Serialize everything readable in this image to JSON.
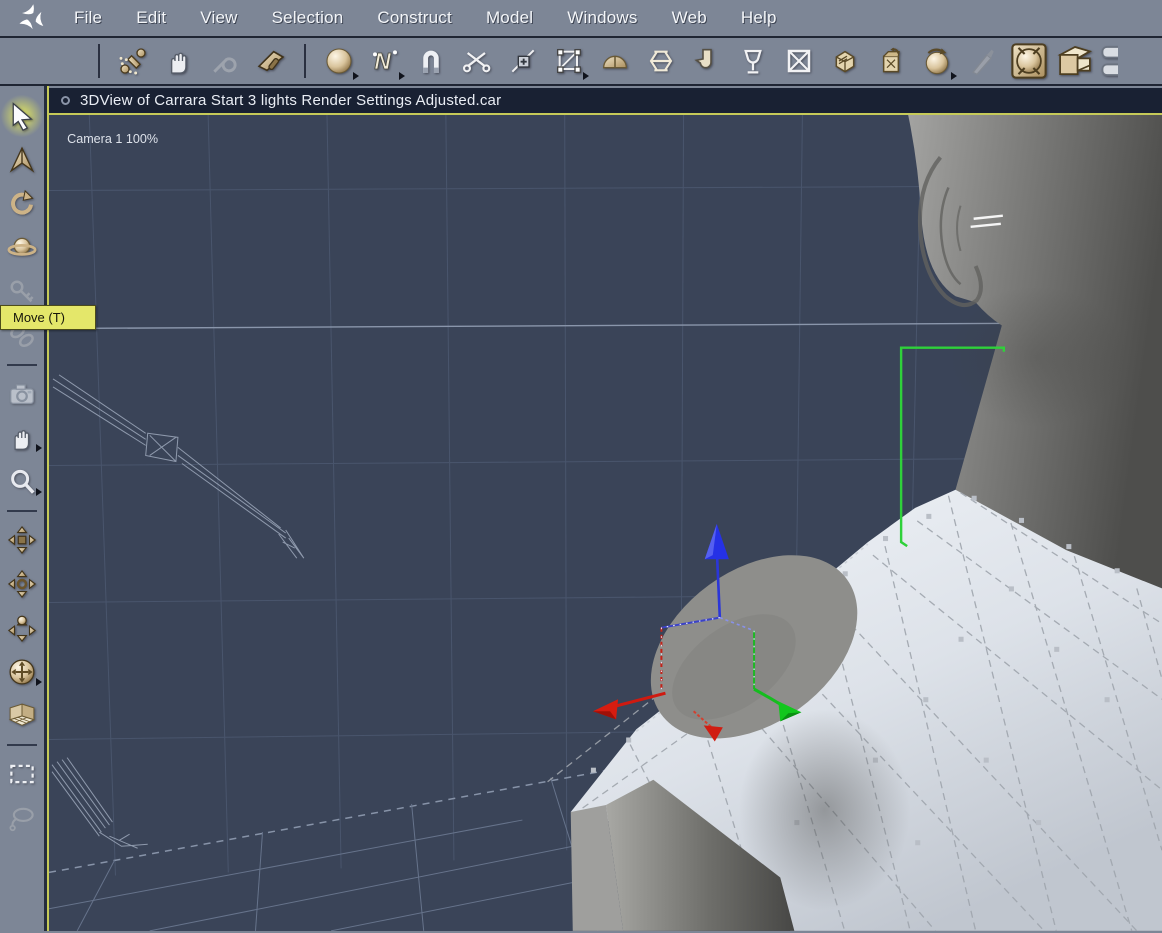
{
  "menubar": {
    "items": [
      {
        "label": "File",
        "name": "menu-file"
      },
      {
        "label": "Edit",
        "name": "menu-edit"
      },
      {
        "label": "View",
        "name": "menu-view"
      },
      {
        "label": "Selection",
        "name": "menu-selection"
      },
      {
        "label": "Construct",
        "name": "menu-construct"
      },
      {
        "label": "Model",
        "name": "menu-model"
      },
      {
        "label": "Windows",
        "name": "menu-windows"
      },
      {
        "label": "Web",
        "name": "menu-web"
      },
      {
        "label": "Help",
        "name": "menu-help"
      }
    ]
  },
  "toolbar": {
    "group1": [
      {
        "icon": "bone-tool",
        "name": "bone-tool-icon"
      },
      {
        "icon": "hand-grab",
        "name": "hand-tool-icon"
      },
      {
        "icon": "wrench",
        "name": "wrench-icon",
        "disabled": true
      },
      {
        "icon": "trowel",
        "name": "trowel-tool-icon"
      }
    ],
    "group2": [
      {
        "icon": "sphere",
        "name": "sphere-primitive-icon",
        "flyout": true
      },
      {
        "icon": "spline-n",
        "name": "spline-curve-icon",
        "flyout": true
      },
      {
        "icon": "magnet",
        "name": "magnet-icon"
      },
      {
        "icon": "scissors",
        "name": "scissors-icon"
      },
      {
        "icon": "add-point",
        "name": "add-point-icon"
      },
      {
        "icon": "lattice",
        "name": "lattice-icon",
        "flyout": true
      },
      {
        "icon": "dome",
        "name": "dome-icon"
      },
      {
        "icon": "lathe",
        "name": "lathe-icon"
      },
      {
        "icon": "bend",
        "name": "bend-extrude-icon"
      },
      {
        "icon": "goblet",
        "name": "goblet-icon"
      },
      {
        "icon": "delete-box",
        "name": "delete-box-icon"
      },
      {
        "icon": "cube",
        "name": "cube-icon"
      },
      {
        "icon": "bag",
        "name": "bag-icon"
      },
      {
        "icon": "sphere-arrow",
        "name": "sphere-arrow-icon",
        "flyout": true
      },
      {
        "icon": "brush",
        "name": "brush-icon",
        "disabled": true
      },
      {
        "icon": "punch",
        "name": "punch-tool-icon",
        "large": true
      },
      {
        "icon": "extrude-3d",
        "name": "extrude-tool-icon",
        "large": true
      },
      {
        "icon": "bolts",
        "name": "bolts-icon",
        "large": true,
        "partial": true
      }
    ]
  },
  "document_window": {
    "title": "3DView of Carrara Start 3 lights Render Settings Adjusted.car"
  },
  "viewport": {
    "camera_label": "Camera 1 100%"
  },
  "tooltip": {
    "text": "Move (T)"
  },
  "sidebar": {
    "tools": [
      {
        "icon": "select-arrow",
        "name": "select-arrow-tool",
        "active": true
      },
      {
        "icon": "move-arrowhead",
        "name": "move-tool"
      },
      {
        "icon": "rotate",
        "name": "rotate-tool"
      },
      {
        "icon": "scale-sphere",
        "name": "scale-tool"
      },
      {
        "icon": "key",
        "name": "key-tool",
        "disabled": true
      },
      {
        "icon": "chain",
        "name": "link-tool",
        "disabled": true
      },
      {
        "divider": true
      },
      {
        "icon": "camera",
        "name": "render-camera-tool",
        "dim": true
      },
      {
        "icon": "pan-hand",
        "name": "pan-tool",
        "flyout": true
      },
      {
        "icon": "magnifier",
        "name": "zoom-tool",
        "flyout": true
      },
      {
        "divider": true
      },
      {
        "icon": "dolly-cross",
        "name": "dolly-camera-tool"
      },
      {
        "icon": "pan-cross-ring",
        "name": "pan-camera-tool"
      },
      {
        "icon": "bank-cross-ball",
        "name": "bank-camera-tool"
      },
      {
        "icon": "trackball",
        "name": "trackball-camera-tool",
        "flyout": true
      },
      {
        "icon": "room-corner",
        "name": "reference-room-tool"
      },
      {
        "divider": true
      },
      {
        "icon": "marquee",
        "name": "marquee-select-tool"
      },
      {
        "icon": "lasso",
        "name": "lasso-select-tool",
        "disabled": true
      }
    ]
  },
  "colors": {
    "viewport_bg": "#3a4458",
    "chrome": "#7d8696",
    "titlebar_bg": "#192133",
    "tooltip_bg": "#e4e76a",
    "active_border": "#c6ca58",
    "gizmo_red": "#d61c10",
    "gizmo_green": "#12c71d",
    "gizmo_blue": "#2531e6",
    "selection_green": "#2fd13a"
  }
}
